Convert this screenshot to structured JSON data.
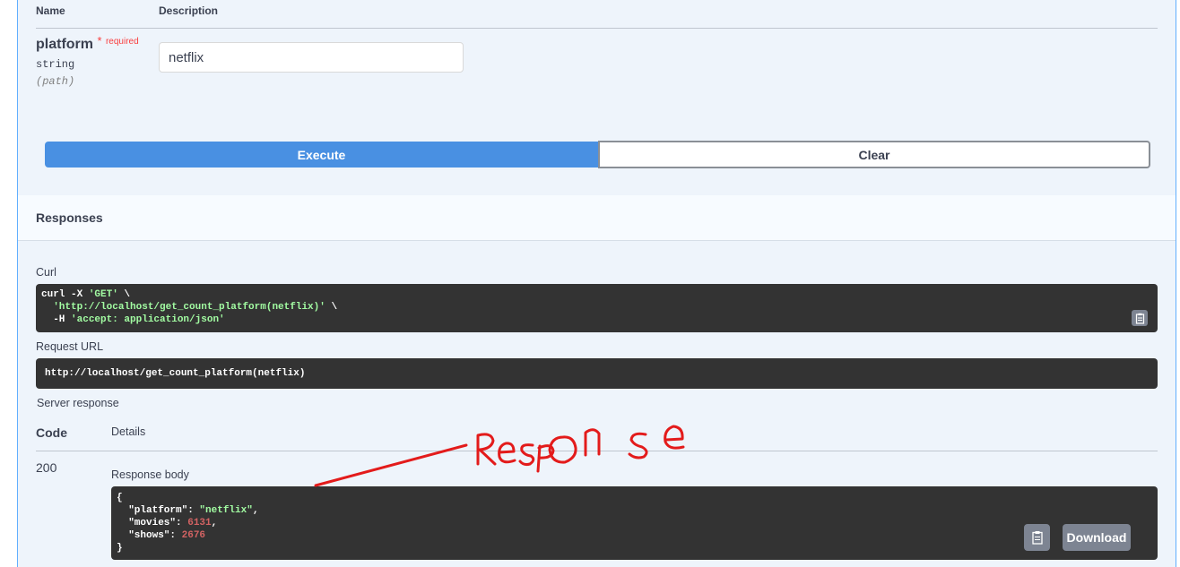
{
  "params": {
    "col_name": "Name",
    "col_description": "Description",
    "param_name": "platform",
    "required_star": "*",
    "required_label": "required",
    "param_type": "string",
    "param_in": "(path)",
    "param_value": "netflix"
  },
  "actions": {
    "execute_label": "Execute",
    "clear_label": "Clear"
  },
  "responses": {
    "title": "Responses",
    "curl_label": "Curl",
    "curl_line1_a": "curl -X ",
    "curl_line1_str": "'GET'",
    "curl_line1_b": " \\",
    "curl_line2_str": "'http://localhost/get_count_platform(netflix)'",
    "curl_line2_b": " \\",
    "curl_line3_a": "  -H ",
    "curl_line3_str": "'accept: application/json'",
    "request_url_label": "Request URL",
    "request_url": "http://localhost/get_count_platform(netflix)",
    "server_response_label": "Server response",
    "code_header": "Code",
    "details_header": "Details",
    "status_code": "200",
    "response_body_label": "Response body",
    "body_open": "{",
    "body_key_platform": "\"platform\"",
    "body_val_platform": "\"netflix\"",
    "body_key_movies": "\"movies\"",
    "body_val_movies": "6131",
    "body_key_shows": "\"shows\"",
    "body_val_shows": "2676",
    "body_close": "}",
    "download_label": "Download"
  },
  "annotation": {
    "handwritten_text": "Response",
    "color": "#e31b1b"
  },
  "colors": {
    "execute_bg": "#4990e2",
    "panel_bg": "#eef4fb",
    "code_bg": "#333333"
  }
}
